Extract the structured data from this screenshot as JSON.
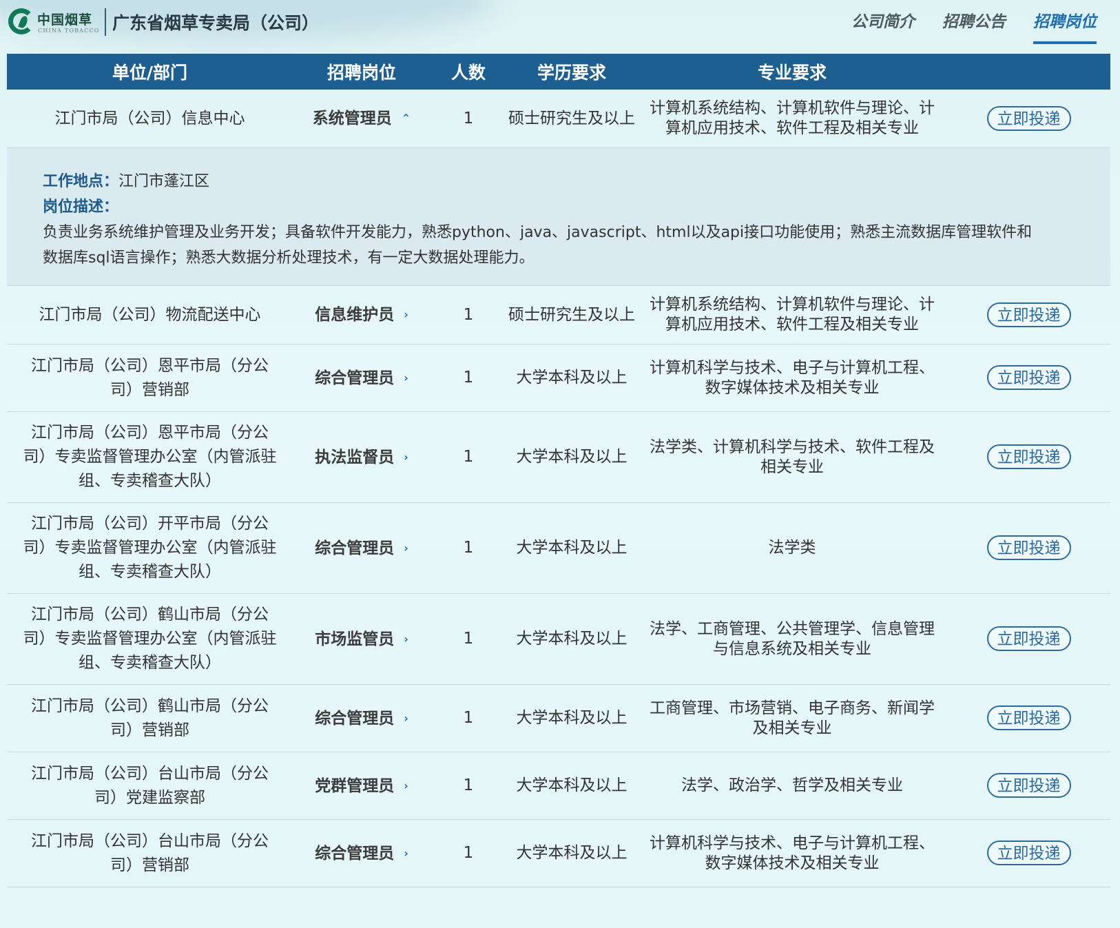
{
  "header": {
    "logo_cn": "中国烟草",
    "logo_en": "CHINA TOBACCO",
    "site_title": "广东省烟草专卖局（公司）",
    "nav": [
      {
        "label": "公司简介",
        "active": false
      },
      {
        "label": "招聘公告",
        "active": false
      },
      {
        "label": "招聘岗位",
        "active": true
      }
    ]
  },
  "table": {
    "headers": [
      "单位/部门",
      "招聘岗位",
      "人数",
      "学历要求",
      "专业要求"
    ],
    "apply_label": "立即投递",
    "rows": [
      {
        "unit": "江门市局（公司）信息中心",
        "position": "系统管理员",
        "count": "1",
        "education": "硕士研究生及以上",
        "major": "计算机系统结构、计算机软件与理论、计算机应用技术、软件工程及相关专业",
        "expanded": true
      },
      {
        "unit": "江门市局（公司）物流配送中心",
        "position": "信息维护员",
        "count": "1",
        "education": "硕士研究生及以上",
        "major": "计算机系统结构、计算机软件与理论、计算机应用技术、软件工程及相关专业"
      },
      {
        "unit": "江门市局（公司）恩平市局（分公司）营销部",
        "position": "综合管理员",
        "count": "1",
        "education": "大学本科及以上",
        "major": "计算机科学与技术、电子与计算机工程、数字媒体技术及相关专业"
      },
      {
        "unit": "江门市局（公司）恩平市局（分公司）专卖监督管理办公室（内管派驻组、专卖稽查大队）",
        "position": "执法监督员",
        "count": "1",
        "education": "大学本科及以上",
        "major": "法学类、计算机科学与技术、软件工程及相关专业"
      },
      {
        "unit": "江门市局（公司）开平市局（分公司）专卖监督管理办公室（内管派驻组、专卖稽查大队）",
        "position": "综合管理员",
        "count": "1",
        "education": "大学本科及以上",
        "major": "法学类"
      },
      {
        "unit": "江门市局（公司）鹤山市局（分公司）专卖监督管理办公室（内管派驻组、专卖稽查大队）",
        "position": "市场监管员",
        "count": "1",
        "education": "大学本科及以上",
        "major": "法学、工商管理、公共管理学、信息管理与信息系统及相关专业"
      },
      {
        "unit": "江门市局（公司）鹤山市局（分公司）营销部",
        "position": "综合管理员",
        "count": "1",
        "education": "大学本科及以上",
        "major": "工商管理、市场营销、电子商务、新闻学及相关专业"
      },
      {
        "unit": "江门市局（公司）台山市局（分公司）党建监察部",
        "position": "党群管理员",
        "count": "1",
        "education": "大学本科及以上",
        "major": "法学、政治学、哲学及相关专业"
      },
      {
        "unit": "江门市局（公司）台山市局（分公司）营销部",
        "position": "综合管理员",
        "count": "1",
        "education": "大学本科及以上",
        "major": "计算机科学与技术、电子与计算机工程、数字媒体技术及相关专业"
      }
    ],
    "detail": {
      "location_label": "工作地点：",
      "location": "江门市蓬江区",
      "desc_label": "岗位描述：",
      "desc": "负责业务系统维护管理及业务开发；具备软件开发能力，熟悉python、java、javascript、html以及api接口功能使用；熟悉主流数据库管理软件和数据库sql语言操作；熟悉大数据分析处理技术，有一定大数据处理能力。"
    }
  },
  "icons": {
    "expanded": "chevron-up-icon",
    "collapsed": "chevron-right-icon"
  },
  "colors": {
    "header_bg": "#1e5f92",
    "accent": "#1f6fb0",
    "logo_green": "#0f7a55"
  }
}
